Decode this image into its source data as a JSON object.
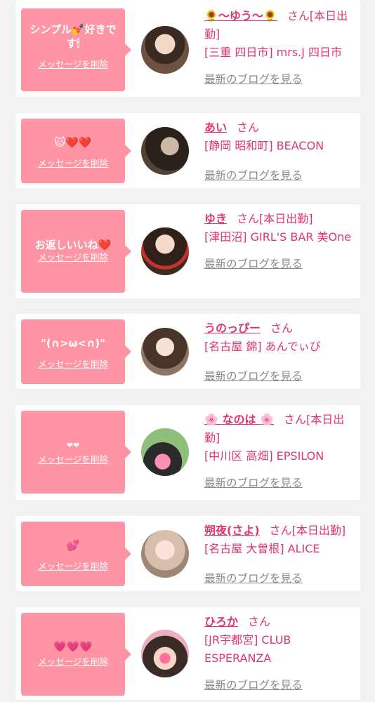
{
  "delete_label": "メッセージを削除",
  "blog_label": "最新のブログを見る",
  "colors": {
    "accent": "#e0366a",
    "bubble": "#ff94a4",
    "background": "#f2f2f3",
    "link_gray": "#8a8a8a"
  },
  "cards": [
    {
      "message": "シンプル💅好きです🕯",
      "name": "🌻〜ゆう〜🌻",
      "honorific": "さん",
      "work": "[本日出勤]",
      "shop": "[三重 四日市] mrs.J 四日市"
    },
    {
      "message": "🐱❤️❤️",
      "name": "あい",
      "honorific": "さん",
      "work": "",
      "shop": "[静岡 昭和町] BEACON"
    },
    {
      "message": "お返しいいね❤️",
      "name": "ゆき",
      "honorific": "さん",
      "work": "[本日出勤]",
      "shop": "[津田沼] GIRL'S BAR 美One"
    },
    {
      "message": "\"(∩>ω<∩)\"",
      "name": "うのっぴー",
      "honorific": "さん",
      "work": "",
      "shop": "[名古屋 錦] あんでぃび"
    },
    {
      "message": "❤❤",
      "name": "🌸 なのは 🌸",
      "honorific": "さん",
      "work": "[本日出勤]",
      "shop": "[中川区 高畑] EPSILON"
    },
    {
      "message": "💕",
      "name": "朔夜(さよ)",
      "honorific": "さん",
      "work": "[本日出勤]",
      "shop": "[名古屋 大曽根] ALICE"
    },
    {
      "message": "💗💗💗",
      "name": "ひろか",
      "honorific": "さん",
      "work": "",
      "shop": "[JR宇都宮] CLUB ESPERANZA"
    }
  ]
}
